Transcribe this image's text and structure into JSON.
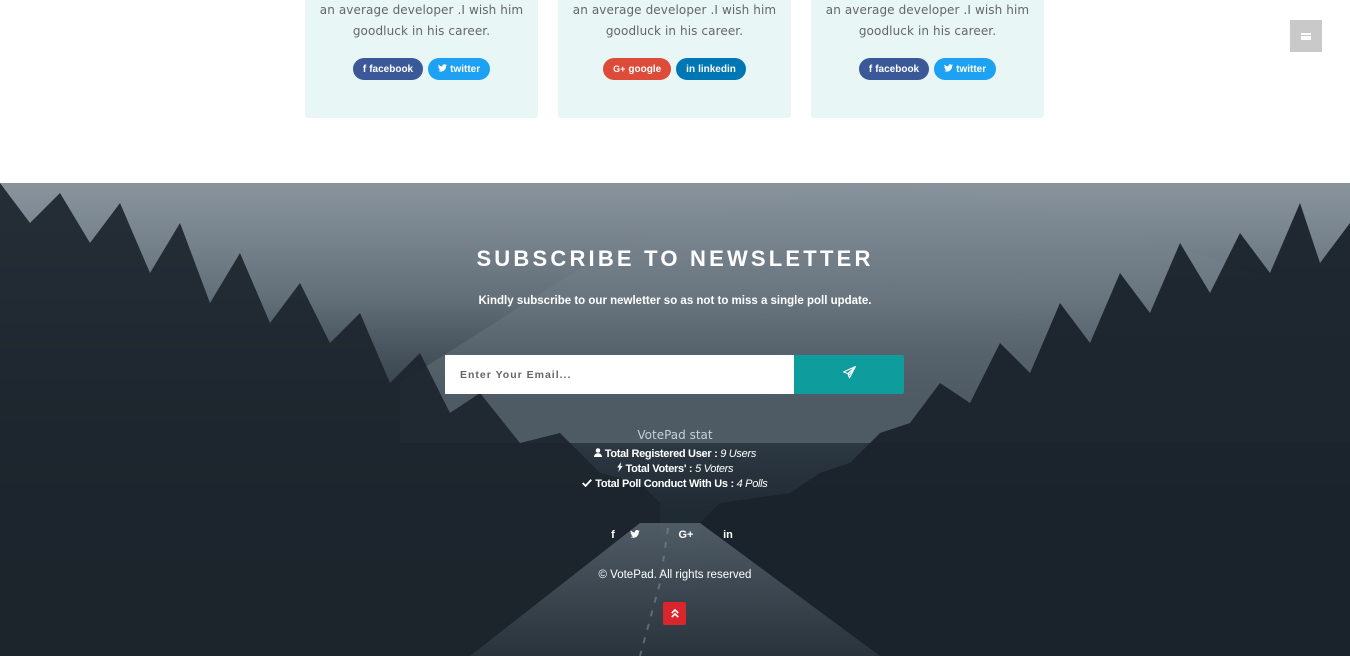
{
  "cards": [
    {
      "desc_line1": "an average developer .I wish him",
      "desc_line2": "goodluck in his career.",
      "buttons": [
        {
          "label": "facebook",
          "icon": "facebook-icon",
          "color": "#3b5998"
        },
        {
          "label": "twitter",
          "icon": "twitter-icon",
          "color": "#1da1f2"
        }
      ]
    },
    {
      "desc_line1": "an average developer .I wish him",
      "desc_line2": "goodluck in his career.",
      "buttons": [
        {
          "label": "google",
          "icon": "google-plus-icon",
          "color": "#dd4b39"
        },
        {
          "label": "linkedin",
          "icon": "linkedin-icon",
          "color": "#0077b5"
        }
      ]
    },
    {
      "desc_line1": "an average developer .I wish him",
      "desc_line2": "goodluck in his career.",
      "buttons": [
        {
          "label": "facebook",
          "icon": "facebook-icon",
          "color": "#3b5998"
        },
        {
          "label": "twitter",
          "icon": "twitter-icon",
          "color": "#1da1f2"
        }
      ]
    }
  ],
  "menu": {
    "icon": "hamburger-menu-icon"
  },
  "newsletter": {
    "title": "SUBSCRIBE TO NEWSLETTER",
    "subtitle": "Kindly subscribe to our newletter so as not to miss a single poll update.",
    "email_placeholder": "Enter Your Email...",
    "submit_icon": "paper-plane-icon",
    "accent_color": "#0e9c9c"
  },
  "stats": {
    "title": "VotePad stat",
    "items": [
      {
        "icon": "user-icon",
        "label": "Total Registered User :",
        "value": "9 Users"
      },
      {
        "icon": "bolt-icon",
        "label": "Total Voters' :",
        "value": "5 Voters"
      },
      {
        "icon": "check-icon",
        "label": "Total Poll Conduct With Us :",
        "value": "4 Polls"
      }
    ]
  },
  "footer_socials": [
    {
      "icon": "facebook-icon"
    },
    {
      "icon": "twitter-icon"
    },
    {
      "icon": "google-plus-icon"
    },
    {
      "icon": "linkedin-icon"
    }
  ],
  "copyright": "© VotePad. All rights reserved",
  "back_to_top": {
    "icon": "double-chevron-up-icon",
    "color": "#d9262c"
  }
}
